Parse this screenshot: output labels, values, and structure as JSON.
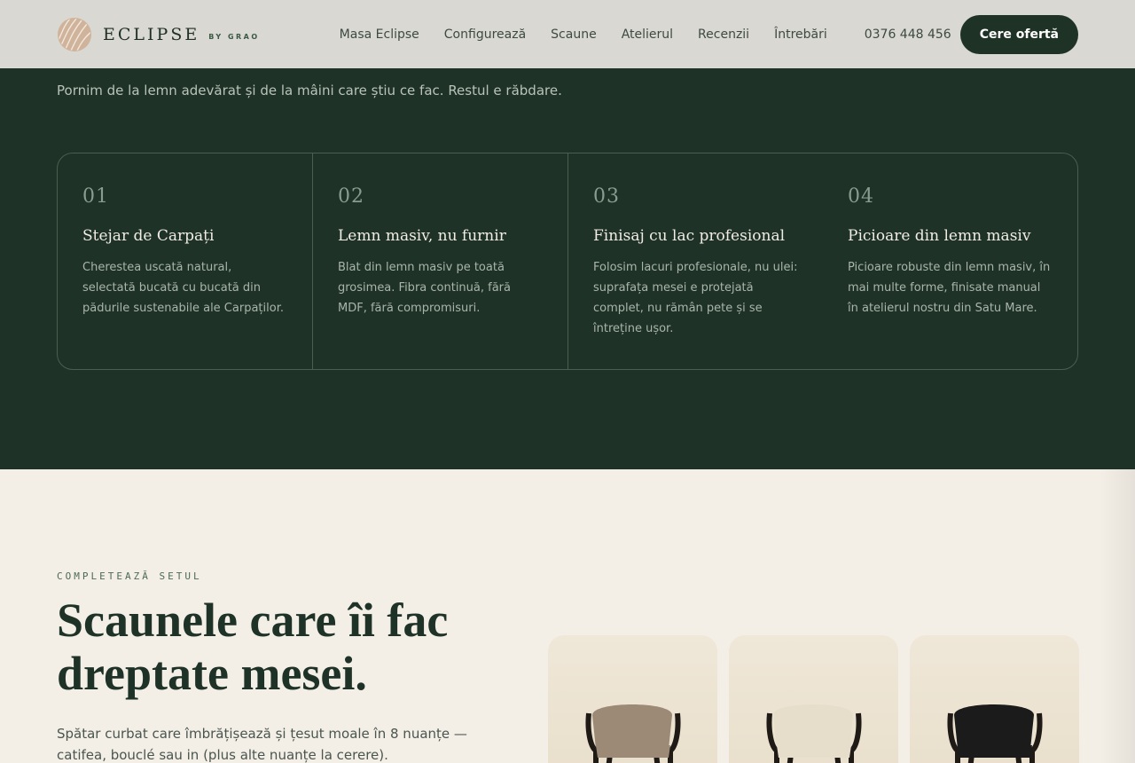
{
  "header": {
    "logo_word": "ECLIPSE",
    "logo_sub": "BY GRAO",
    "nav": [
      "Masa Eclipse",
      "Configurează",
      "Scaune",
      "Atelierul",
      "Recenzii",
      "Întrebări"
    ],
    "phone": "0376 448 456",
    "cta": "Cere ofertă"
  },
  "intro": "Pornim de la lemn adevărat și de la mâini care știu ce fac. Restul e răbdare.",
  "features": [
    {
      "num": "01",
      "title": "Stejar de Carpați",
      "desc": "Cherestea uscată natural, selectată bucată cu bucată din pădurile sustenabile ale Carpaților."
    },
    {
      "num": "02",
      "title": "Lemn masiv, nu furnir",
      "desc": "Blat din lemn masiv pe toată grosimea. Fibra continuă, fără MDF, fără compromisuri."
    },
    {
      "num": "03",
      "title": "Finisaj cu lac profesional",
      "desc": "Folosim lacuri profesionale, nu ulei: suprafața mesei e protejată complet, nu rămân pete și se întreține ușor."
    },
    {
      "num": "04",
      "title": "Picioare din lemn masiv",
      "desc": "Picioare robuste din lemn masiv, în mai multe forme, finisate manual în atelierul nostru din Satu Mare."
    }
  ],
  "chairs_section": {
    "eyebrow": "COMPLETEAZĂ SETUL",
    "headline": "Scaunele care îi fac dreptate mesei.",
    "subtext": "Spătar curbat care îmbrățișează și țesut moale în 8 nuanțe — catifea, bouclé sau in (plus alte nuanțe la cerere).",
    "chairs": [
      {
        "color": "#9c8a77"
      },
      {
        "color": "#e7ddcb"
      },
      {
        "color": "#1b1b1b"
      }
    ]
  },
  "colors": {
    "dark_green": "#1f3227",
    "cream": "#f3efe7",
    "header_bg": "#d9d8d2"
  }
}
